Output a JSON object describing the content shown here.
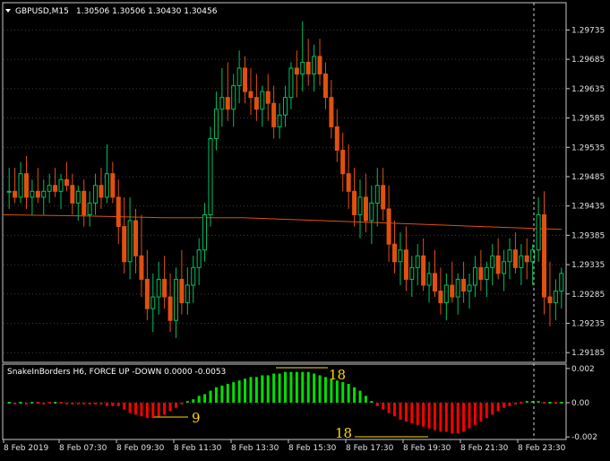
{
  "header": {
    "menu_icon": "triangle-down-icon",
    "symbol": "GBPUSD,M15",
    "ohlc": "1.30506 1.30506 1.30430 1.30456"
  },
  "indicator": {
    "label": "SnakeInBorders H6, FORCE UP -DOWN  0.0000 -0.0053",
    "annotations": [
      "18",
      "9",
      "18"
    ]
  },
  "price_axis": {
    "ticks": [
      "1.29735",
      "1.29685",
      "1.29635",
      "1.29585",
      "1.29535",
      "1.29485",
      "1.29435",
      "1.29385",
      "1.29335",
      "1.29285",
      "1.29235",
      "1.29185"
    ]
  },
  "indicator_axis": {
    "ticks": [
      "0.002",
      "0.00",
      "-0.002"
    ]
  },
  "time_axis": {
    "ticks": [
      "8 Feb 2019",
      "8 Feb 07:30",
      "8 Feb 09:30",
      "8 Feb 11:30",
      "8 Feb 13:30",
      "8 Feb 15:30",
      "8 Feb 17:30",
      "8 Feb 19:30",
      "8 Feb 21:30",
      "8 Feb 23:30"
    ]
  },
  "colors": {
    "background": "#000000",
    "bull": "#00c060",
    "bear": "#e05010",
    "ma": "#e05010",
    "hist_up": "#00e000",
    "hist_down": "#ff0000",
    "grid": "#3a3a3a",
    "frame": "#c8c8c8",
    "annotation": "#ffd800"
  },
  "chart_data": [
    {
      "type": "candlestick",
      "title": "GBPUSD,M15",
      "ylim": [
        1.2917,
        1.2978
      ],
      "candles": [
        [
          1.2946,
          1.295,
          1.2943,
          1.2946
        ],
        [
          1.2946,
          1.295,
          1.2944,
          1.2945
        ],
        [
          1.2945,
          1.2951,
          1.2944,
          1.2949
        ],
        [
          1.2949,
          1.2952,
          1.2943,
          1.2945
        ],
        [
          1.2945,
          1.2948,
          1.2942,
          1.2946
        ],
        [
          1.2946,
          1.295,
          1.2944,
          1.2945
        ],
        [
          1.2945,
          1.2948,
          1.2942,
          1.2946
        ],
        [
          1.2946,
          1.2949,
          1.2944,
          1.2947
        ],
        [
          1.2947,
          1.295,
          1.2945,
          1.2946
        ],
        [
          1.2946,
          1.2949,
          1.2943,
          1.2948
        ],
        [
          1.2948,
          1.2951,
          1.2946,
          1.2947
        ],
        [
          1.2947,
          1.2949,
          1.2942,
          1.2944
        ],
        [
          1.2944,
          1.2947,
          1.2941,
          1.2946
        ],
        [
          1.2946,
          1.2948,
          1.294,
          1.2942
        ],
        [
          1.2942,
          1.2946,
          1.294,
          1.2944
        ],
        [
          1.2944,
          1.2949,
          1.2942,
          1.2947
        ],
        [
          1.2947,
          1.295,
          1.2943,
          1.2945
        ],
        [
          1.2945,
          1.2954,
          1.2944,
          1.2949
        ],
        [
          1.2949,
          1.2951,
          1.2944,
          1.2945
        ],
        [
          1.2945,
          1.2948,
          1.2937,
          1.294
        ],
        [
          1.294,
          1.2945,
          1.2932,
          1.2934
        ],
        [
          1.2934,
          1.2945,
          1.2931,
          1.2941
        ],
        [
          1.2941,
          1.2943,
          1.2932,
          1.2935
        ],
        [
          1.2935,
          1.2942,
          1.2928,
          1.2931
        ],
        [
          1.2931,
          1.2936,
          1.2924,
          1.2926
        ],
        [
          1.2926,
          1.2932,
          1.2922,
          1.2928
        ],
        [
          1.2928,
          1.2934,
          1.2925,
          1.2931
        ],
        [
          1.2931,
          1.2935,
          1.2926,
          1.2928
        ],
        [
          1.2928,
          1.2932,
          1.2922,
          1.2924
        ],
        [
          1.2924,
          1.2933,
          1.2921,
          1.2931
        ],
        [
          1.2931,
          1.2936,
          1.2925,
          1.2927
        ],
        [
          1.2927,
          1.2933,
          1.2925,
          1.293
        ],
        [
          1.293,
          1.2935,
          1.2927,
          1.2933
        ],
        [
          1.2933,
          1.2938,
          1.293,
          1.2936
        ],
        [
          1.2936,
          1.2944,
          1.2934,
          1.2942
        ],
        [
          1.2942,
          1.2957,
          1.294,
          1.2955
        ],
        [
          1.2955,
          1.2963,
          1.2953,
          1.296
        ],
        [
          1.296,
          1.2967,
          1.2957,
          1.2962
        ],
        [
          1.2962,
          1.2968,
          1.2958,
          1.296
        ],
        [
          1.296,
          1.2966,
          1.2957,
          1.2964
        ],
        [
          1.2964,
          1.297,
          1.2961,
          1.2967
        ],
        [
          1.2967,
          1.2969,
          1.2961,
          1.2963
        ],
        [
          1.2963,
          1.2967,
          1.2959,
          1.2962
        ],
        [
          1.2962,
          1.2966,
          1.2958,
          1.296
        ],
        [
          1.296,
          1.2964,
          1.2957,
          1.2963
        ],
        [
          1.2963,
          1.2966,
          1.2958,
          1.2961
        ],
        [
          1.2961,
          1.2964,
          1.2955,
          1.2957
        ],
        [
          1.2957,
          1.2961,
          1.2955,
          1.2959
        ],
        [
          1.2959,
          1.2964,
          1.2957,
          1.2962
        ],
        [
          1.2962,
          1.2968,
          1.296,
          1.2967
        ],
        [
          1.2967,
          1.297,
          1.2962,
          1.2966
        ],
        [
          1.2966,
          1.2975,
          1.2963,
          1.2968
        ],
        [
          1.2968,
          1.2972,
          1.2964,
          1.2966
        ],
        [
          1.2966,
          1.2971,
          1.2963,
          1.2969
        ],
        [
          1.2969,
          1.2972,
          1.2964,
          1.2966
        ],
        [
          1.2966,
          1.2968,
          1.296,
          1.2962
        ],
        [
          1.2962,
          1.2965,
          1.2955,
          1.2957
        ],
        [
          1.2957,
          1.296,
          1.2951,
          1.2953
        ],
        [
          1.2953,
          1.2956,
          1.2946,
          1.2949
        ],
        [
          1.2949,
          1.2954,
          1.2943,
          1.2946
        ],
        [
          1.2946,
          1.295,
          1.294,
          1.2942
        ],
        [
          1.2942,
          1.2948,
          1.2938,
          1.2945
        ],
        [
          1.2945,
          1.2949,
          1.2939,
          1.2941
        ],
        [
          1.2941,
          1.2947,
          1.2937,
          1.2944
        ],
        [
          1.2944,
          1.295,
          1.294,
          1.2947
        ],
        [
          1.2947,
          1.295,
          1.2941,
          1.2943
        ],
        [
          1.2943,
          1.2947,
          1.2934,
          1.2937
        ],
        [
          1.2937,
          1.2941,
          1.2932,
          1.2934
        ],
        [
          1.2934,
          1.2939,
          1.293,
          1.2936
        ],
        [
          1.2936,
          1.294,
          1.2929,
          1.2931
        ],
        [
          1.2931,
          1.2935,
          1.2928,
          1.2933
        ],
        [
          1.2933,
          1.2937,
          1.293,
          1.2935
        ],
        [
          1.2935,
          1.2938,
          1.2929,
          1.293
        ],
        [
          1.293,
          1.2934,
          1.2927,
          1.2932
        ],
        [
          1.2932,
          1.2936,
          1.2928,
          1.2929
        ],
        [
          1.2929,
          1.2933,
          1.2925,
          1.2927
        ],
        [
          1.2927,
          1.2932,
          1.2924,
          1.293
        ],
        [
          1.293,
          1.2934,
          1.2927,
          1.2928
        ],
        [
          1.2928,
          1.2932,
          1.2925,
          1.2931
        ],
        [
          1.2931,
          1.2934,
          1.2927,
          1.2929
        ],
        [
          1.2929,
          1.2932,
          1.2926,
          1.293
        ],
        [
          1.293,
          1.2935,
          1.2928,
          1.2933
        ],
        [
          1.2933,
          1.2936,
          1.2929,
          1.2931
        ],
        [
          1.2931,
          1.2934,
          1.2928,
          1.2933
        ],
        [
          1.2933,
          1.2937,
          1.293,
          1.2935
        ],
        [
          1.2935,
          1.2938,
          1.2931,
          1.2932
        ],
        [
          1.2932,
          1.2936,
          1.2929,
          1.2934
        ],
        [
          1.2934,
          1.2938,
          1.2931,
          1.2936
        ],
        [
          1.2936,
          1.2939,
          1.2932,
          1.2933
        ],
        [
          1.2933,
          1.2937,
          1.293,
          1.2935
        ],
        [
          1.2935,
          1.2938,
          1.2931,
          1.2934
        ],
        [
          1.2934,
          1.2937,
          1.293,
          1.2936
        ],
        [
          1.2936,
          1.2945,
          1.2934,
          1.2942
        ],
        [
          1.2942,
          1.2946,
          1.2925,
          1.2928
        ],
        [
          1.2928,
          1.2934,
          1.2923,
          1.2927
        ],
        [
          1.2927,
          1.2931,
          1.2924,
          1.2929
        ],
        [
          1.2929,
          1.2933,
          1.2926,
          1.2932
        ]
      ],
      "series": [
        {
          "name": "MA",
          "values": [
            1.2942,
            1.29418,
            1.29415,
            1.29415,
            1.2941,
            1.29405,
            1.294,
            1.29395
          ]
        }
      ]
    },
    {
      "type": "bar",
      "title": "SnakeInBorders H6, FORCE UP -DOWN",
      "ylim": [
        -0.0022,
        0.0022
      ],
      "values": [
        0,
        -0.0001,
        0,
        -0.0001,
        0,
        0,
        -0.0001,
        0,
        0,
        0,
        -0.0001,
        -0.0001,
        -0.0001,
        -0.0001,
        -0.0001,
        -0.0001,
        -0.0001,
        -0.0002,
        -0.0002,
        -0.0002,
        -0.0004,
        -0.0006,
        -0.0007,
        -0.0008,
        -0.0009,
        -0.0009,
        -0.0008,
        -0.0007,
        -0.0005,
        -0.0003,
        -0.0001,
        0.0001,
        0.0002,
        0.0004,
        0.0005,
        0.0007,
        0.0009,
        0.001,
        0.0011,
        0.0012,
        0.0013,
        0.0014,
        0.0015,
        0.0015,
        0.0016,
        0.0016,
        0.0017,
        0.0017,
        0.0018,
        0.0018,
        0.0018,
        0.0018,
        0.0018,
        0.0017,
        0.0016,
        0.0015,
        0.0014,
        0.0013,
        0.0012,
        0.0011,
        0.0009,
        0.0007,
        0.0004,
        0.0001,
        -0.0002,
        -0.0004,
        -0.0006,
        -0.0008,
        -0.001,
        -0.0011,
        -0.0012,
        -0.0013,
        -0.0014,
        -0.0015,
        -0.0016,
        -0.0017,
        -0.0017,
        -0.0018,
        -0.0018,
        -0.0017,
        -0.0015,
        -0.0013,
        -0.0011,
        -0.0009,
        -0.0007,
        -0.0005,
        -0.0003,
        -0.0002,
        -0.0001,
        0,
        0.0001,
        0.0001,
        0.0001,
        0,
        0,
        0,
        0
      ]
    }
  ]
}
